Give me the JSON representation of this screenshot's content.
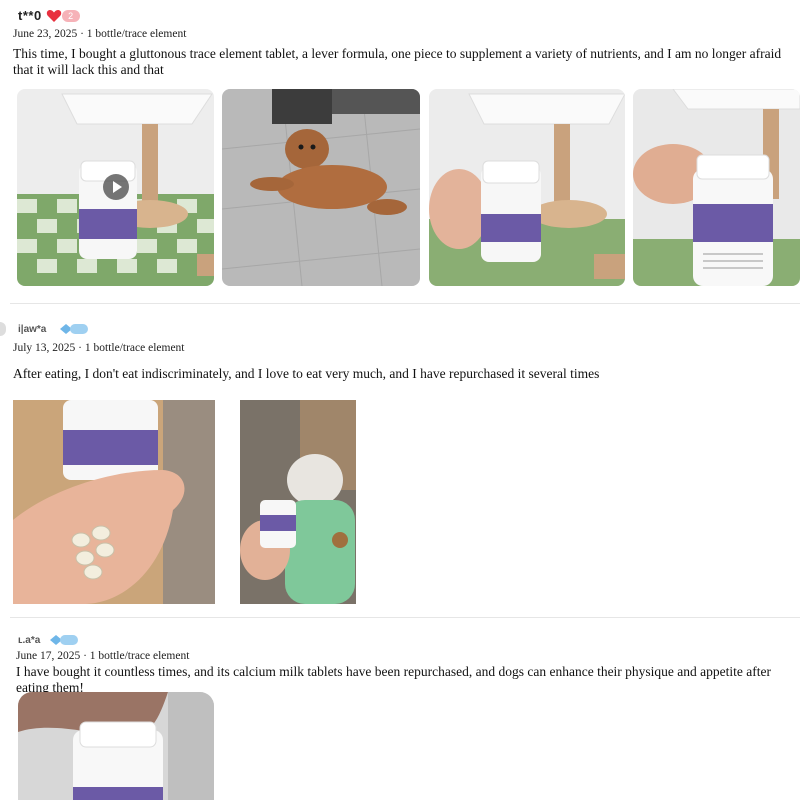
{
  "reviews": [
    {
      "username": "t**0",
      "level": "2",
      "date": "June 23, 2025 · 1 bottle/trace element",
      "text": "This time, I bought a gluttonous trace element tablet, a lever formula, one piece to supplement a variety of nutrients, and I am no longer afraid that it will lack this and that",
      "photos": [
        {
          "name": "bottle-on-table-video",
          "has_play": true
        },
        {
          "name": "dog-on-floor",
          "has_play": false
        },
        {
          "name": "bottle-in-hand",
          "has_play": false
        },
        {
          "name": "bottle-closeup",
          "has_play": false
        }
      ]
    },
    {
      "username": "i|aw*a",
      "date": "July 13, 2025 · 1 bottle/trace element",
      "text": "After eating, I don't eat indiscriminately, and I love to eat very much, and I have repurchased it several times",
      "photos": [
        {
          "name": "tablets-in-palm"
        },
        {
          "name": "cat-with-bottle"
        }
      ]
    },
    {
      "username": "ʟ.a*a",
      "date": "June 17, 2025 · 1 bottle/trace element",
      "text": "I have bought it countless times, and its calcium milk tablets have been repurchased, and dogs can enhance their physique and appetite after eating them!",
      "photos": [
        {
          "name": "hand-holding-bottle"
        }
      ]
    }
  ]
}
